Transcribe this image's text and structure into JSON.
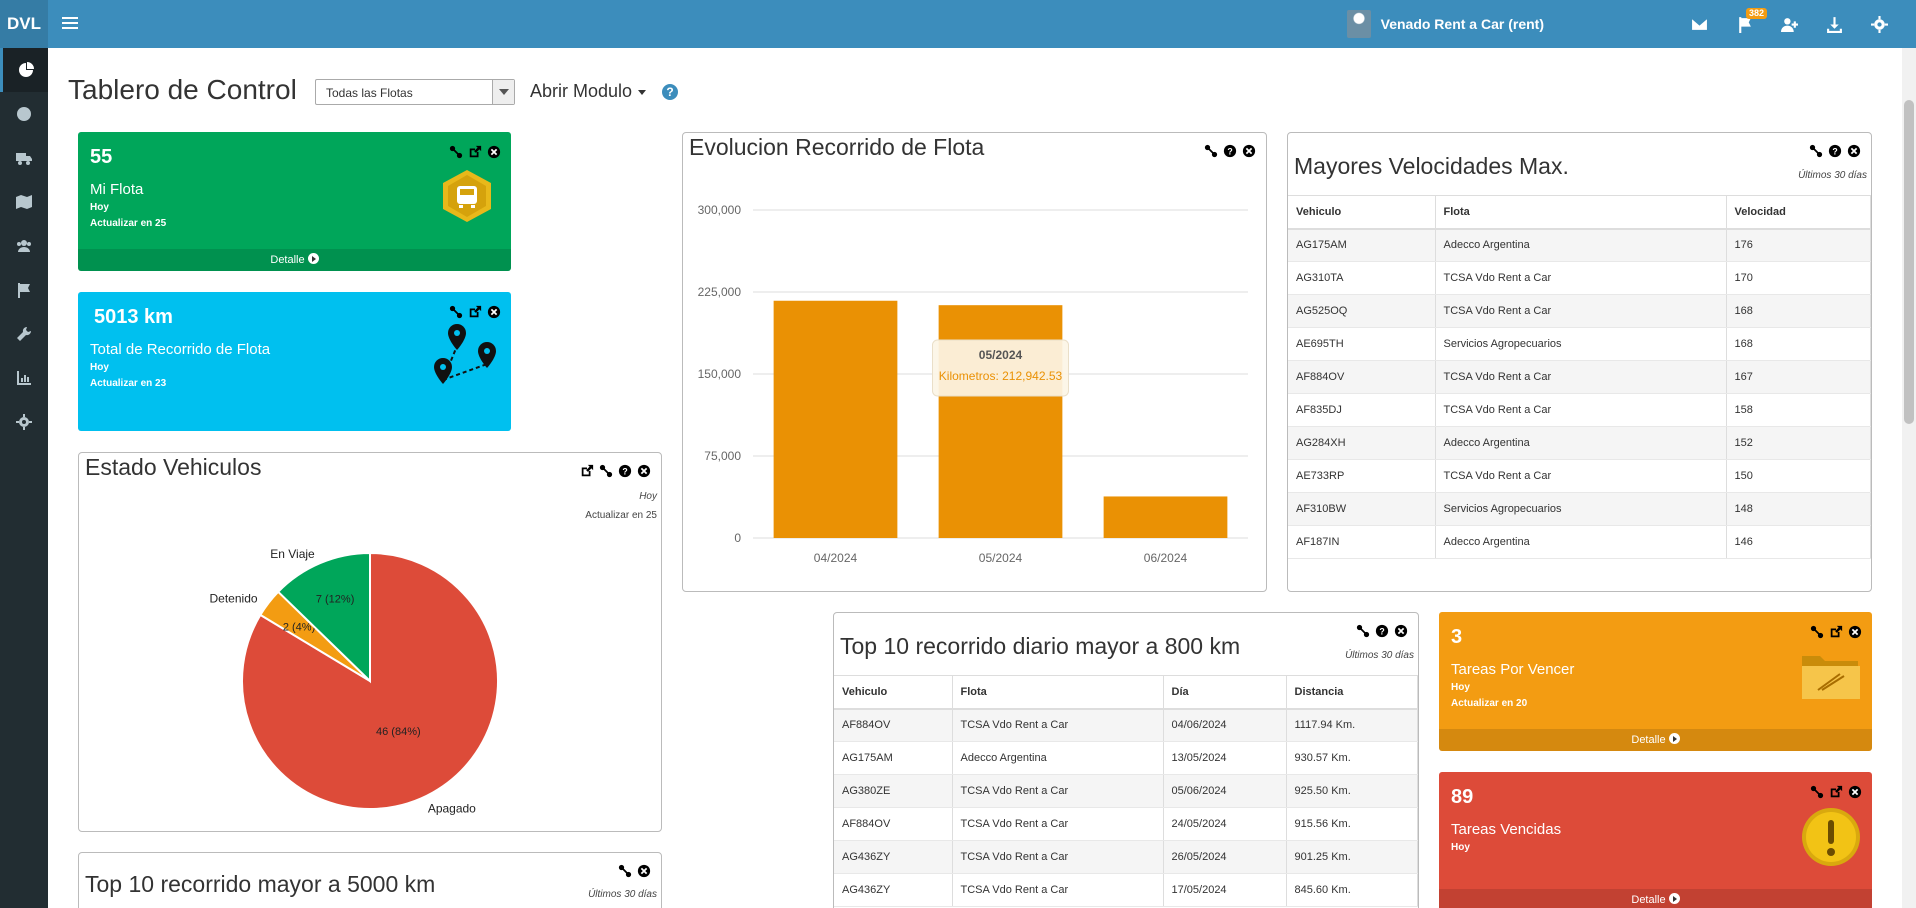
{
  "app": {
    "logo": "DVL",
    "account": "Venado Rent a Car (rent)",
    "notif_count": "382"
  },
  "header": {
    "title": "Tablero de Control",
    "fleet_select": "Todas las Flotas",
    "open_module": "Abrir Modulo",
    "help": "?"
  },
  "sidebar": {
    "items": [
      "dashboard-icon",
      "globe-icon",
      "truck-icon",
      "map-icon",
      "users-icon",
      "flag-icon",
      "wrench-icon",
      "chart-icon",
      "gear-icon"
    ]
  },
  "cards": {
    "fleet": {
      "value": "55",
      "label": "Mi Flota",
      "period": "Hoy",
      "update": "Actualizar en 25",
      "footer": "Detalle",
      "color": "#00a65a"
    },
    "distance": {
      "value": "5013 km",
      "label": "Total de Recorrido de Flota",
      "period": "Hoy",
      "update": "Actualizar en 23",
      "color": "#00c0ef"
    },
    "tasks_due": {
      "value": "3",
      "label": "Tareas Por Vencer",
      "period": "Hoy",
      "update": "Actualizar en 20",
      "footer": "Detalle",
      "color": "#f39c12"
    },
    "tasks_overdue": {
      "value": "89",
      "label": "Tareas Vencidas",
      "period": "Hoy",
      "footer": "Detalle",
      "color": "#dd4b39"
    }
  },
  "vehicle_status": {
    "title": "Estado Vehiculos",
    "period": "Hoy",
    "update": "Actualizar en 25",
    "slices": [
      {
        "name": "Apagado",
        "value": 46,
        "label": "46 (84%)",
        "color": "#dd4b39"
      },
      {
        "name": "Detenido",
        "value": 2,
        "label": "2 (4%)",
        "color": "#f39c12"
      },
      {
        "name": "En Viaje",
        "value": 7,
        "label": "7 (12%)",
        "color": "#00a65a"
      }
    ]
  },
  "fleet_evolution": {
    "title": "Evolucion Recorrido de Flota",
    "tooltip": {
      "title": "05/2024",
      "text": "Kilometros: 212,942.53"
    }
  },
  "chart_data": {
    "type": "bar",
    "title": "Evolucion Recorrido de Flota",
    "categories": [
      "04/2024",
      "05/2024",
      "06/2024"
    ],
    "values": [
      217000,
      212942.53,
      38000
    ],
    "yticks": [
      "300,000",
      "225,000",
      "150,000",
      "75,000",
      "0"
    ],
    "ylim": [
      0,
      300000
    ],
    "color": "#ea9104",
    "grid": true
  },
  "max_speeds": {
    "title": "Mayores Velocidades Max.",
    "period": "Últimos 30 días",
    "columns": [
      "Vehiculo",
      "Flota",
      "Velocidad"
    ],
    "rows": [
      [
        "AG175AM",
        "Adecco Argentina",
        "176"
      ],
      [
        "AG310TA",
        "TCSA Vdo Rent a Car",
        "170"
      ],
      [
        "AG525OQ",
        "TCSA Vdo Rent a Car",
        "168"
      ],
      [
        "AE695TH",
        "Servicios Agropecuarios",
        "168"
      ],
      [
        "AF884OV",
        "TCSA Vdo Rent a Car",
        "167"
      ],
      [
        "AF835DJ",
        "TCSA Vdo Rent a Car",
        "158"
      ],
      [
        "AG284XH",
        "Adecco Argentina",
        "152"
      ],
      [
        "AE733RP",
        "TCSA Vdo Rent a Car",
        "150"
      ],
      [
        "AF310BW",
        "Servicios Agropecuarios",
        "148"
      ],
      [
        "AF187IN",
        "Adecco Argentina",
        "146"
      ]
    ]
  },
  "daily_top": {
    "title": "Top 10 recorrido diario mayor a 800 km",
    "period": "Últimos 30 días",
    "columns": [
      "Vehiculo",
      "Flota",
      "Día",
      "Distancia"
    ],
    "rows": [
      [
        "AF884OV",
        "TCSA Vdo Rent a Car",
        "04/06/2024",
        "1117.94 Km."
      ],
      [
        "AG175AM",
        "Adecco Argentina",
        "13/05/2024",
        "930.57 Km."
      ],
      [
        "AG380ZE",
        "TCSA Vdo Rent a Car",
        "05/06/2024",
        "925.50 Km."
      ],
      [
        "AF884OV",
        "TCSA Vdo Rent a Car",
        "24/05/2024",
        "915.56 Km."
      ],
      [
        "AG436ZY",
        "TCSA Vdo Rent a Car",
        "26/05/2024",
        "901.25 Km."
      ],
      [
        "AG436ZY",
        "TCSA Vdo Rent a Car",
        "17/05/2024",
        "845.60 Km."
      ]
    ]
  },
  "top_5000": {
    "title": "Top 10 recorrido mayor a 5000 km",
    "period": "Últimos 30 días"
  }
}
